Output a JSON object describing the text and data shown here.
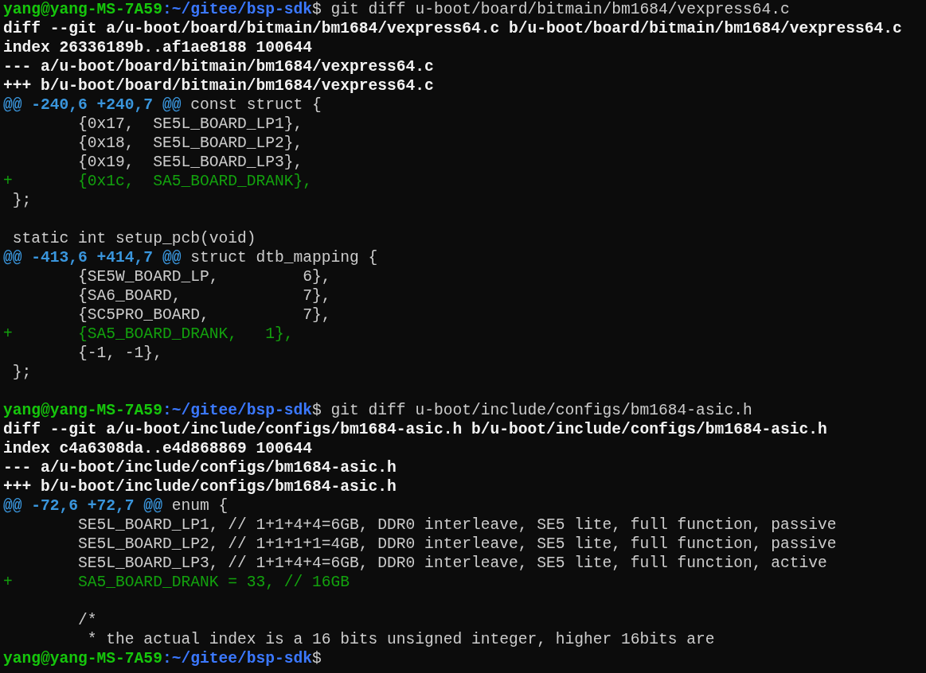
{
  "terminal": {
    "lines": [
      {
        "kind": "command",
        "user_host": "yang@yang-MS-7A59",
        "path": ":~/gitee/bsp-sdk",
        "symbol": "$",
        "command": " git diff u-boot/board/bitmain/bm1684/vexpress64.c"
      },
      {
        "kind": "meta",
        "text": "diff --git a/u-boot/board/bitmain/bm1684/vexpress64.c b/u-boot/board/bitmain/bm1684/vexpress64.c"
      },
      {
        "kind": "meta",
        "text": "index 26336189b..af1ae8188 100644"
      },
      {
        "kind": "meta",
        "text": "--- a/u-boot/board/bitmain/bm1684/vexpress64.c"
      },
      {
        "kind": "meta",
        "text": "+++ b/u-boot/board/bitmain/bm1684/vexpress64.c"
      },
      {
        "kind": "hunk",
        "marker": "@@ -240,6 +240,7 @@",
        "context": " const struct {"
      },
      {
        "kind": "context",
        "text": "        {0x17,  SE5L_BOARD_LP1},"
      },
      {
        "kind": "context",
        "text": "        {0x18,  SE5L_BOARD_LP2},"
      },
      {
        "kind": "context",
        "text": "        {0x19,  SE5L_BOARD_LP3},"
      },
      {
        "kind": "added",
        "text": "+       {0x1c,  SA5_BOARD_DRANK},"
      },
      {
        "kind": "context",
        "text": " };"
      },
      {
        "kind": "blank"
      },
      {
        "kind": "context",
        "text": " static int setup_pcb(void)"
      },
      {
        "kind": "hunk",
        "marker": "@@ -413,6 +414,7 @@",
        "context": " struct dtb_mapping {"
      },
      {
        "kind": "context",
        "text": "        {SE5W_BOARD_LP,         6},"
      },
      {
        "kind": "context",
        "text": "        {SA6_BOARD,             7},"
      },
      {
        "kind": "context",
        "text": "        {SC5PRO_BOARD,          7},"
      },
      {
        "kind": "added",
        "text": "+       {SA5_BOARD_DRANK,   1},"
      },
      {
        "kind": "context",
        "text": "        {-1, -1},"
      },
      {
        "kind": "context",
        "text": " };"
      },
      {
        "kind": "blank"
      },
      {
        "kind": "command",
        "user_host": "yang@yang-MS-7A59",
        "path": ":~/gitee/bsp-sdk",
        "symbol": "$",
        "command": " git diff u-boot/include/configs/bm1684-asic.h"
      },
      {
        "kind": "meta",
        "text": "diff --git a/u-boot/include/configs/bm1684-asic.h b/u-boot/include/configs/bm1684-asic.h"
      },
      {
        "kind": "meta",
        "text": "index c4a6308da..e4d868869 100644"
      },
      {
        "kind": "meta",
        "text": "--- a/u-boot/include/configs/bm1684-asic.h"
      },
      {
        "kind": "meta",
        "text": "+++ b/u-boot/include/configs/bm1684-asic.h"
      },
      {
        "kind": "hunk",
        "marker": "@@ -72,6 +72,7 @@",
        "context": " enum {"
      },
      {
        "kind": "context",
        "text": "        SE5L_BOARD_LP1, // 1+1+4+4=6GB, DDR0 interleave, SE5 lite, full function, passive"
      },
      {
        "kind": "context",
        "text": "        SE5L_BOARD_LP2, // 1+1+1+1=4GB, DDR0 interleave, SE5 lite, full function, passive"
      },
      {
        "kind": "context",
        "text": "        SE5L_BOARD_LP3, // 1+1+4+4=6GB, DDR0 interleave, SE5 lite, full function, active"
      },
      {
        "kind": "added",
        "text": "+       SA5_BOARD_DRANK = 33, // 16GB"
      },
      {
        "kind": "blank"
      },
      {
        "kind": "context",
        "text": "        /*"
      },
      {
        "kind": "context",
        "text": "         * the actual index is a 16 bits unsigned integer, higher 16bits are"
      },
      {
        "kind": "command",
        "user_host": "yang@yang-MS-7A59",
        "path": ":~/gitee/bsp-sdk",
        "symbol": "$"
      }
    ]
  }
}
